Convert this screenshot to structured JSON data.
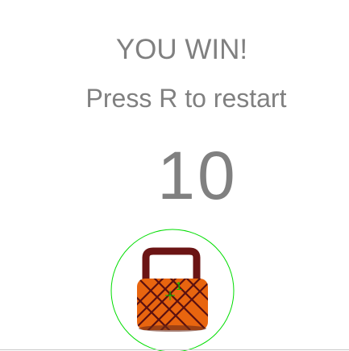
{
  "game": {
    "message": "YOU WIN!",
    "restart_hint": "Press R to restart",
    "score": "10",
    "player_debug_label": "1"
  },
  "colors": {
    "text": "#808080",
    "hitbox": "#00dd00",
    "basket_body": "#e8650f",
    "basket_weave": "#5a1010",
    "basket_handle": "#6b1414"
  },
  "icons": {
    "player": "basket-icon"
  }
}
